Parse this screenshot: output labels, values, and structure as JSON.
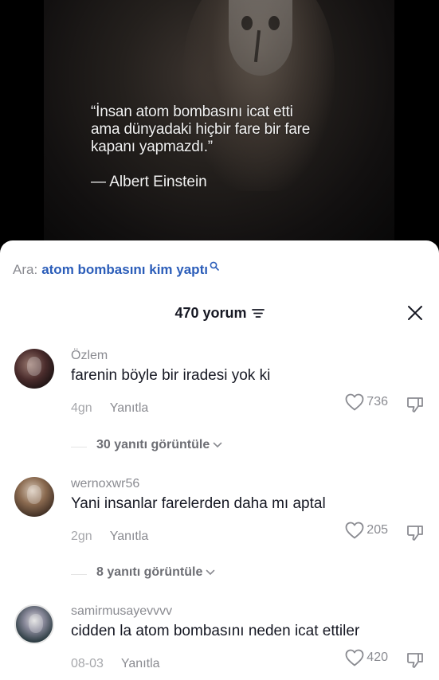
{
  "video": {
    "quote_lines": [
      "“İnsan atom bombasını icat etti",
      "ama dünyadaki hiçbir fare bir fare",
      "kapanı yapmazdı.”"
    ],
    "author": "— Albert Einstein"
  },
  "search": {
    "prefix": "Ara:",
    "term": "atom bombasını kim yaptı",
    "icon": "search-icon"
  },
  "header": {
    "count_label": "470 yorum",
    "sort_icon": "sort-lines-icon",
    "close_icon": "close-icon"
  },
  "comments": [
    {
      "username": "Özlem",
      "text": "farenin böyle bir iradesi yok ki",
      "time": "4gn",
      "reply_label": "Yanıtla",
      "likes": "736",
      "view_replies": "30 yanıtı görüntüle"
    },
    {
      "username": "wernoxwr56",
      "text": "Yani insanlar farelerden daha mı aptal",
      "time": "2gn",
      "reply_label": "Yanıtla",
      "likes": "205",
      "view_replies": "8 yanıtı görüntüle"
    },
    {
      "username": "samirmusayevvvv",
      "text": "cidden la atom bombasını neden icat ettiler",
      "time": "08-03",
      "reply_label": "Yanıtla",
      "likes": "420"
    }
  ],
  "colors": {
    "search_term": "#2b5db9",
    "text_primary": "#161823",
    "text_secondary": "#8a8b91"
  }
}
